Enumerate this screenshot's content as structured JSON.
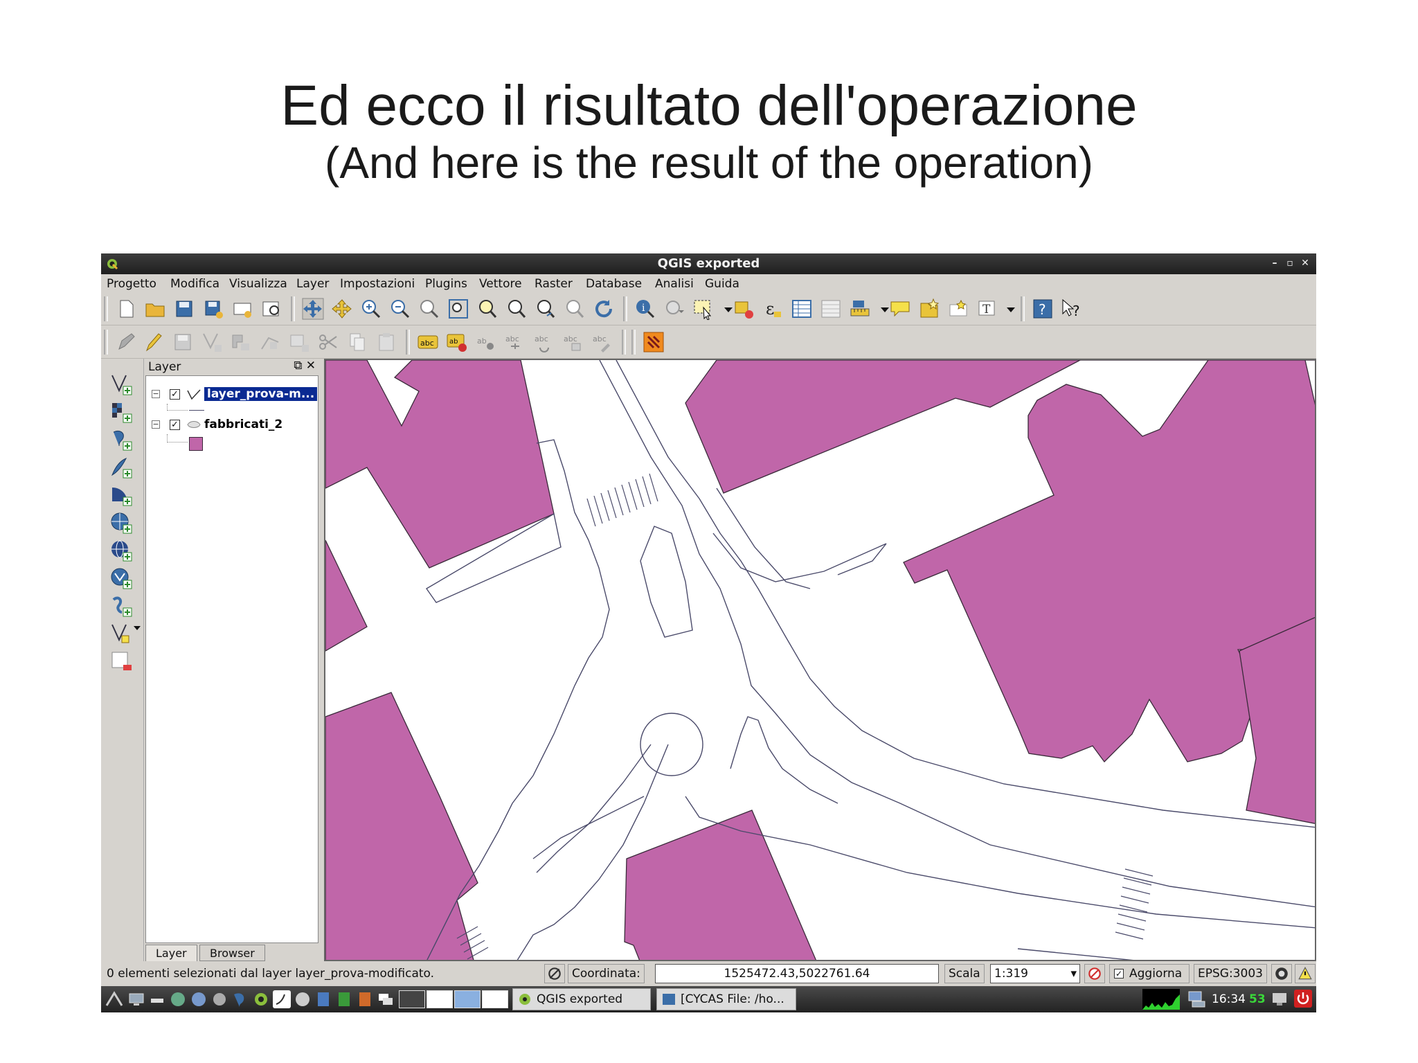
{
  "slide": {
    "title": "Ed ecco il risultato dell'operazione",
    "subtitle": "(And here is the result of the operation)"
  },
  "window": {
    "title": "QGIS exported",
    "controls": [
      "minimize-icon",
      "restore-icon",
      "close-icon"
    ]
  },
  "menu": {
    "items": [
      "Progetto",
      "Modifica",
      "Visualizza",
      "Layer",
      "Impostazioni",
      "Plugins",
      "Vettore",
      "Raster",
      "Database",
      "Analisi",
      "Guida"
    ]
  },
  "layers": {
    "panel_title": "Layer",
    "panel_buttons": "⧉ ✕",
    "items": [
      {
        "name": "layer_prova-m...",
        "checked": true,
        "selected": true,
        "icon": "line-layer-icon"
      },
      {
        "name": "fabbricati_2",
        "checked": true,
        "selected": false,
        "icon": "polygon-layer-icon"
      }
    ],
    "tabs": [
      "Layer",
      "Browser"
    ]
  },
  "status": {
    "message": "0 elementi selezionati dal layer layer_prova-modificato.",
    "coord_label": "Coordinata:",
    "coord_value": "1525472.43,5022761.64",
    "scale_label": "Scala",
    "scale_value": "1:319",
    "render_label": "Aggiorna",
    "render_checked": true,
    "crs": "EPSG:3003"
  },
  "taskbar": {
    "tasks": [
      "QGIS exported",
      "[CYCAS  File: /ho..."
    ],
    "clock": "16:34",
    "cpu_value": "53"
  },
  "colors": {
    "building_fill": "#c066a9",
    "building_stroke": "#3a2a3a",
    "road_stroke": "#4a4a6a",
    "selected_bg": "#0a2a92"
  }
}
